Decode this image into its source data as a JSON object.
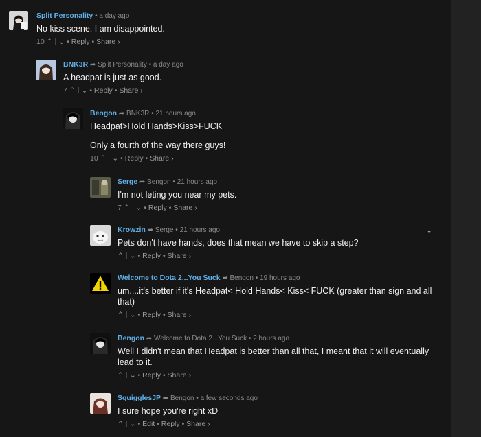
{
  "comments": [
    {
      "author": "Split Personality",
      "parent": "",
      "time": "a day ago",
      "body": [
        "No kiss scene, I am disappointed."
      ],
      "votes": "10",
      "actions": [
        "Reply",
        "Share ›"
      ]
    },
    {
      "author": "BNK3R",
      "parent": "Split Personality",
      "time": "a day ago",
      "body": [
        "A headpat is just as good."
      ],
      "votes": "7",
      "actions": [
        "Reply",
        "Share ›"
      ]
    },
    {
      "author": "Bengon",
      "parent": "BNK3R",
      "time": "21 hours ago",
      "body": [
        "Headpat>Hold Hands>Kiss>FUCK",
        "Only a fourth of the way there guys!"
      ],
      "votes": "10",
      "actions": [
        "Reply",
        "Share ›"
      ]
    },
    {
      "author": "Serge",
      "parent": "Bengon",
      "time": "21 hours ago",
      "body": [
        "I'm not leting you near my pets."
      ],
      "votes": "7",
      "actions": [
        "Reply",
        "Share ›"
      ]
    },
    {
      "author": "Krowzin",
      "parent": "Serge",
      "time": "21 hours ago",
      "body": [
        "Pets don't have hands, does that mean we have to skip a step?"
      ],
      "votes": "",
      "actions": [
        "Reply",
        "Share ›"
      ]
    },
    {
      "author": "Welcome to Dota 2...You Suck",
      "parent": "Bengon",
      "time": "19 hours ago",
      "body": [
        "um....it's better if it's Headpat< Hold Hands< Kiss< FUCK (greater than sign and all that)"
      ],
      "votes": "",
      "actions": [
        "Reply",
        "Share ›"
      ]
    },
    {
      "author": "Bengon",
      "parent": "Welcome to Dota 2...You Suck",
      "time": "2 hours ago",
      "body": [
        "Well I didn't mean that Headpat is better than all that, I meant that it will eventually lead to it."
      ],
      "votes": "",
      "actions": [
        "Reply",
        "Share ›"
      ]
    },
    {
      "author": "SquigglesJP",
      "parent": "Bengon",
      "time": "a few seconds ago",
      "body": [
        "I sure hope you're right xD"
      ],
      "votes": "",
      "actions": [
        "Edit",
        "Reply",
        "Share ›"
      ]
    }
  ],
  "icons": {
    "upvote": "chevron-up-icon",
    "downvote": "chevron-down-icon",
    "reply_arrow": "reply-arrow-icon"
  },
  "colors": {
    "background": "#161616",
    "author": "#5fb0ea",
    "meta": "#8a8a8a"
  }
}
